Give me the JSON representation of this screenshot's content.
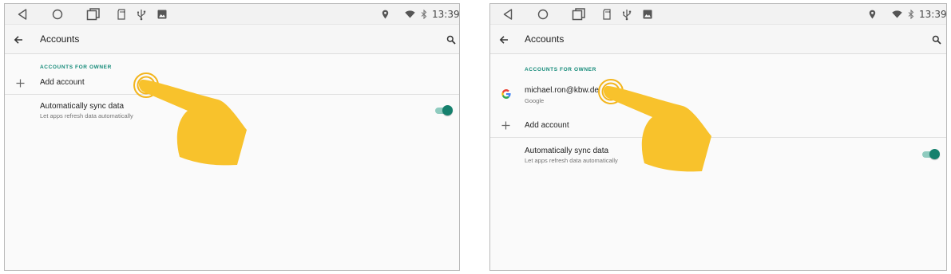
{
  "statusbar": {
    "nav_icons": [
      "back-triangle-icon",
      "home-circle-icon",
      "recents-square-icon",
      "sd-card-icon",
      "usb-icon",
      "image-icon"
    ],
    "status_icons": [
      "location-icon",
      "wifi-icon",
      "bluetooth-icon"
    ],
    "time": "13:39"
  },
  "screens": [
    {
      "toolbar": {
        "title": "Accounts"
      },
      "section_header": "ACCOUNTS FOR OWNER",
      "add_account_label": "Add account",
      "sync": {
        "title": "Automatically sync data",
        "subtitle": "Let apps refresh data automatically",
        "enabled": true
      }
    },
    {
      "toolbar": {
        "title": "Accounts"
      },
      "section_header": "ACCOUNTS FOR OWNER",
      "account": {
        "email": "michael.ron@kbw.de",
        "provider": "Google"
      },
      "add_account_label": "Add account",
      "sync": {
        "title": "Automatically sync data",
        "subtitle": "Let apps refresh data automatically",
        "enabled": true
      }
    }
  ],
  "colors": {
    "accent": "#138a78",
    "toggle_thumb": "#15806d",
    "toggle_track": "#8fcbbf",
    "hand": "#f8c22c",
    "ring": "#f3b51d"
  }
}
